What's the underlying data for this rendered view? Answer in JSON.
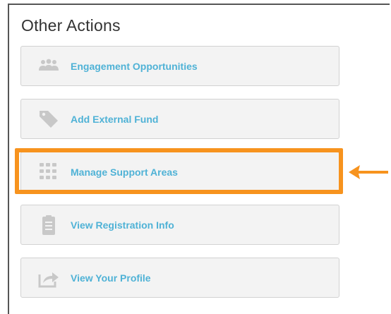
{
  "panel": {
    "title": "Other Actions"
  },
  "actions": [
    {
      "label": "Engagement Opportunities",
      "icon": "people-group-icon"
    },
    {
      "label": "Add External Fund",
      "icon": "tag-icon"
    },
    {
      "label": "Manage Support Areas",
      "icon": "grid-dots-icon"
    },
    {
      "label": "View Registration Info",
      "icon": "clipboard-icon"
    },
    {
      "label": "View Your Profile",
      "icon": "share-arrow-icon"
    }
  ],
  "highlight": {
    "target": "Manage Support Areas",
    "color": "#f7931e"
  },
  "colors": {
    "label": "#4fb2d6",
    "icon": "#c8c8c8",
    "button_bg": "#f3f3f3"
  }
}
